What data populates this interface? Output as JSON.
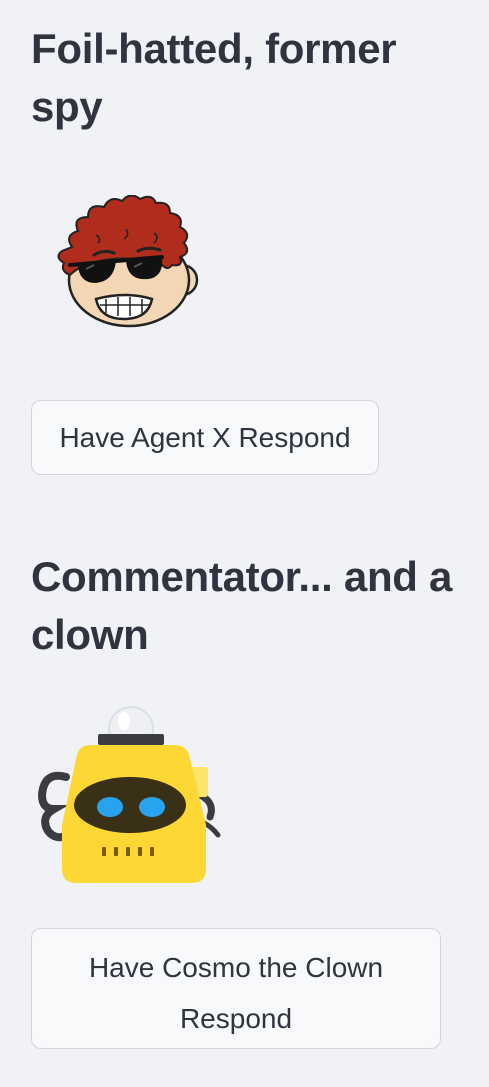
{
  "sections": [
    {
      "title": "Foil-hatted, former spy",
      "avatar_icon": "sunglasses-redhead-face-icon",
      "button_label": "Have Agent X Respond"
    },
    {
      "title": "Commentator... and a clown",
      "avatar_icon": "yellow-robot-icon",
      "button_label": "Have Cosmo the Clown Respond"
    }
  ],
  "colors": {
    "background": "#f0f2f6",
    "text": "#31333f",
    "button_bg": "#f8f9fb",
    "button_border": "#d4d6dc",
    "hair": "#b02c1c",
    "skin": "#f3d6b4",
    "robot_yellow": "#fdd835",
    "robot_eye": "#29a3ee"
  }
}
